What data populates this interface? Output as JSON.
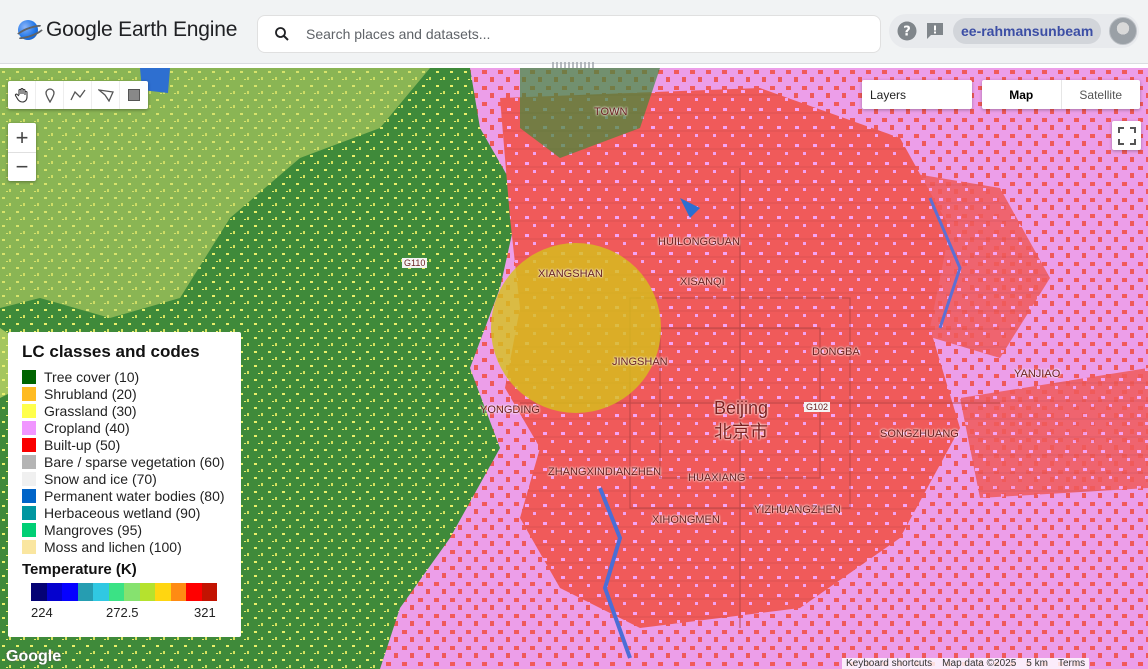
{
  "app": {
    "title": "Google Earth Engine",
    "logo_icon": "earth-engine-logo-icon"
  },
  "search": {
    "placeholder": "Search places and datasets..."
  },
  "header": {
    "help_icon": "help-icon",
    "feedback_icon": "feedback-icon",
    "username": "ee-rahmansunbeam",
    "avatar_icon": "avatar-icon"
  },
  "map": {
    "layers_label": "Layers",
    "map_type_options": [
      "Map",
      "Satellite"
    ],
    "map_type_selected": "Map",
    "zoom_in": "+",
    "zoom_out": "−",
    "tools": [
      "pan-hand-icon",
      "point-marker-icon",
      "line-draw-icon",
      "polygon-draw-icon",
      "rectangle-draw-icon"
    ],
    "city_en": "Beijing",
    "city_zh": "北京市",
    "place_labels": [
      "TOWN",
      "XIANGSHAN",
      "HUILONGGUAN",
      "XISANQI",
      "YONGDING",
      "JINGSHAN",
      "ZHANGXINDIANZHEN",
      "HUAXIANG",
      "XIHONGMEN",
      "YIZHUANGZHEN",
      "DONGBA",
      "YANJIAO",
      "SONGZHUANG"
    ],
    "road_labels": [
      "G102",
      "G110"
    ],
    "google_wordmark": "Google",
    "attribution": [
      "Keyboard shortcuts",
      "Map data ©2025",
      "5 km",
      "Terms"
    ]
  },
  "legend": {
    "title": "LC classes and codes",
    "classes": [
      {
        "label": "Tree cover (10)",
        "color": "#006400"
      },
      {
        "label": "Shrubland (20)",
        "color": "#ffbb22"
      },
      {
        "label": "Grassland (30)",
        "color": "#ffff4c"
      },
      {
        "label": "Cropland (40)",
        "color": "#f096ff"
      },
      {
        "label": "Built-up (50)",
        "color": "#fa0000"
      },
      {
        "label": "Bare / sparse vegetation (60)",
        "color": "#b4b4b4"
      },
      {
        "label": "Snow and ice (70)",
        "color": "#f0f0f0"
      },
      {
        "label": "Permanent water bodies (80)",
        "color": "#0064c8"
      },
      {
        "label": "Herbaceous wetland (90)",
        "color": "#0096a0"
      },
      {
        "label": "Mangroves (95)",
        "color": "#00cf75"
      },
      {
        "label": "Moss and lichen (100)",
        "color": "#fae6a0"
      }
    ],
    "temperature": {
      "title": "Temperature (K)",
      "palette": [
        "#040274",
        "#0502ce",
        "#0602ff",
        "#269db1",
        "#30c8e2",
        "#3be285",
        "#86e26f",
        "#b5e22e",
        "#ffd611",
        "#ff8b13",
        "#ff0000",
        "#c21301"
      ],
      "min": "224",
      "mid": "272.5",
      "max": "321"
    }
  }
}
